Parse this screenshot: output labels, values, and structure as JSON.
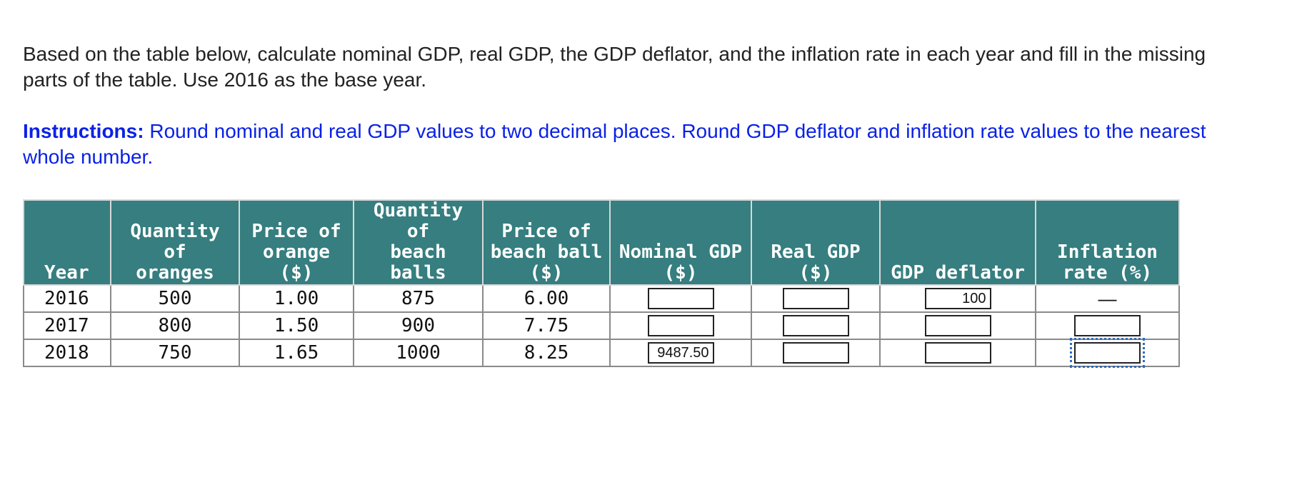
{
  "question": {
    "text": "Based on the table below, calculate nominal GDP, real GDP, the GDP deflator, and the inflation rate in each year and fill in the missing parts of the table. Use 2016 as the base year."
  },
  "instructions": {
    "lead": "Instructions:",
    "text": " Round nominal and real GDP values to two decimal places. Round GDP deflator and inflation rate values to the nearest whole number."
  },
  "colors": {
    "header_bg": "#367e7f",
    "instructions_text": "#0a21e6",
    "focus_outline": "#2e6ac2"
  },
  "table": {
    "headers": [
      [
        "Year"
      ],
      [
        "Quantity of",
        "oranges"
      ],
      [
        "Price of",
        "orange",
        "($)"
      ],
      [
        "Quantity of",
        "beach",
        "balls"
      ],
      [
        "Price of",
        "beach ball",
        "($)"
      ],
      [
        "Nominal GDP",
        "($)"
      ],
      [
        "Real GDP",
        "($)"
      ],
      [
        "GDP deflator"
      ],
      [
        "Inflation",
        "rate (%)"
      ]
    ],
    "rows": [
      {
        "year": "2016",
        "qty_oranges": "500",
        "price_orange": "1.00",
        "qty_beach_balls": "875",
        "price_beach_ball": "6.00",
        "nominal_gdp": "",
        "real_gdp": "",
        "gdp_deflator": "100",
        "inflation_rate": "—"
      },
      {
        "year": "2017",
        "qty_oranges": "800",
        "price_orange": "1.50",
        "qty_beach_balls": "900",
        "price_beach_ball": "7.75",
        "nominal_gdp": "",
        "real_gdp": "",
        "gdp_deflator": "",
        "inflation_rate": ""
      },
      {
        "year": "2018",
        "qty_oranges": "750",
        "price_orange": "1.65",
        "qty_beach_balls": "1000",
        "price_beach_ball": "8.25",
        "nominal_gdp": "9487.50",
        "real_gdp": "",
        "gdp_deflator": "",
        "inflation_rate": ""
      }
    ]
  }
}
